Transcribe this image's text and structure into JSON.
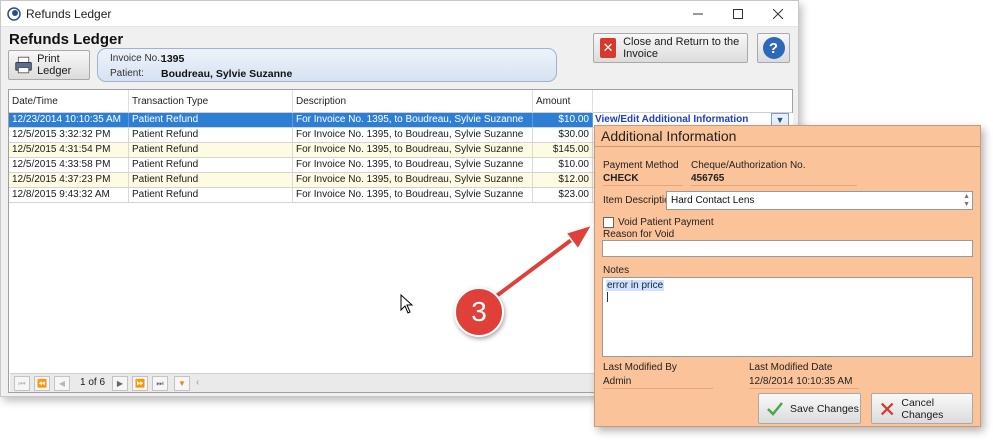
{
  "window": {
    "title": "Refunds Ledger",
    "heading": "Refunds Ledger"
  },
  "toolbar": {
    "print_label": "Print Ledger",
    "return_label": "Close and Return to the Invoice",
    "help_label": "?"
  },
  "invoice": {
    "invoice_label": "Invoice No.:",
    "invoice_value": "1395",
    "patient_label": "Patient:",
    "patient_value": "Boudreau, Sylvie Suzanne"
  },
  "grid": {
    "columns": [
      "Date/Time",
      "Transaction Type",
      "Description",
      "Amount"
    ],
    "rows": [
      {
        "datetime": "12/23/2014 10:10:35 AM",
        "type": "Patient Refund",
        "description": "For Invoice No. 1395, to Boudreau, Sylvie Suzanne",
        "amount": "$10.00",
        "selected": true
      },
      {
        "datetime": "12/5/2015 3:32:32 PM",
        "type": "Patient Refund",
        "description": "For Invoice No. 1395, to Boudreau, Sylvie Suzanne",
        "amount": "$30.00"
      },
      {
        "datetime": "12/5/2015 4:31:54 PM",
        "type": "Patient Refund",
        "description": "For Invoice No. 1395, to Boudreau, Sylvie Suzanne",
        "amount": "$145.00"
      },
      {
        "datetime": "12/5/2015 4:33:58 PM",
        "type": "Patient Refund",
        "description": "For Invoice No. 1395, to Boudreau, Sylvie Suzanne",
        "amount": "$10.00"
      },
      {
        "datetime": "12/5/2015 4:37:23 PM",
        "type": "Patient Refund",
        "description": "For Invoice No. 1395, to Boudreau, Sylvie Suzanne",
        "amount": "$12.00"
      },
      {
        "datetime": "12/8/2015 9:43:32 AM",
        "type": "Patient Refund",
        "description": "For Invoice No. 1395, to Boudreau, Sylvie Suzanne",
        "amount": "$23.00"
      }
    ],
    "view_edit_label": "View/Edit Additional Information"
  },
  "pager": {
    "page_text": "1 of 6"
  },
  "popup": {
    "title": "Additional Information",
    "payment_method_label": "Payment Method",
    "payment_method_value": "CHECK",
    "cheque_label": "Cheque/Authorization No.",
    "cheque_value": "456765",
    "item_description_label": "Item Description",
    "item_description_value": "Hard Contact Lens",
    "void_label": "Void Patient Payment",
    "reason_label": "Reason for Void",
    "reason_value": "",
    "notes_label": "Notes",
    "notes_value": "error in price",
    "last_modified_by_label": "Last Modified By",
    "last_modified_by_value": "Admin",
    "last_modified_date_label": "Last Modified Date",
    "last_modified_date_value": "12/8/2014 10:10:35 AM",
    "save_label": "Save Changes",
    "cancel_label": "Cancel Changes"
  },
  "annotation": {
    "step_number": "3"
  },
  "colors": {
    "selection": "#2d7fd6",
    "popup_bg": "#fbc39a",
    "badge": "#e0403a",
    "link": "#1e3fbf"
  }
}
